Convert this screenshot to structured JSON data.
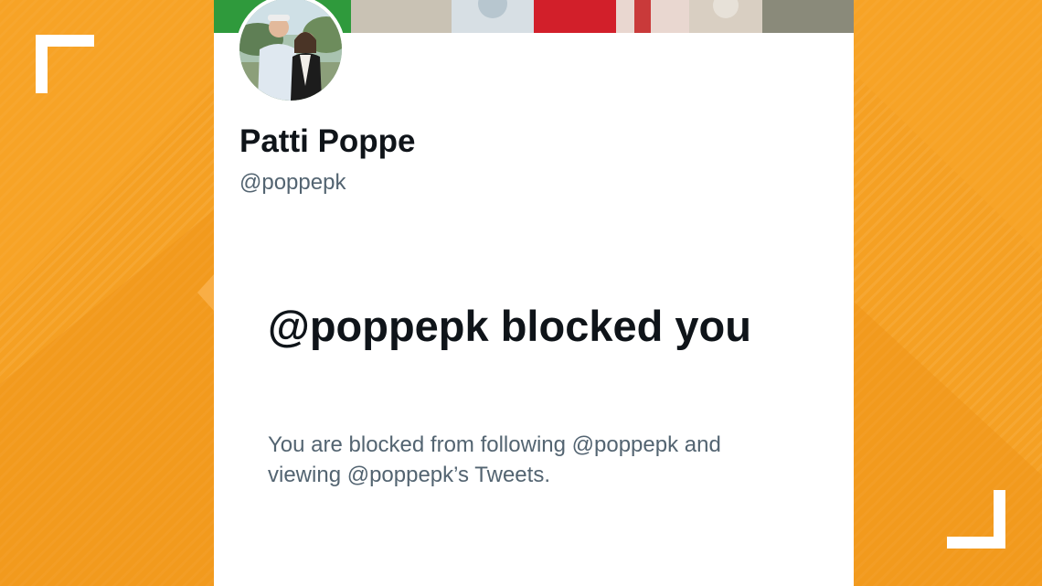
{
  "profile": {
    "display_name": "Patti Poppe",
    "handle": "@poppepk"
  },
  "blocked_notice": {
    "title": "@poppepk blocked you",
    "description": "You are blocked from following @poppepk and viewing @poppepk’s Tweets."
  },
  "colors": {
    "background_orange": "#f5a023",
    "card_background": "#ffffff",
    "primary_text": "#0f1419",
    "secondary_text": "#536471"
  }
}
